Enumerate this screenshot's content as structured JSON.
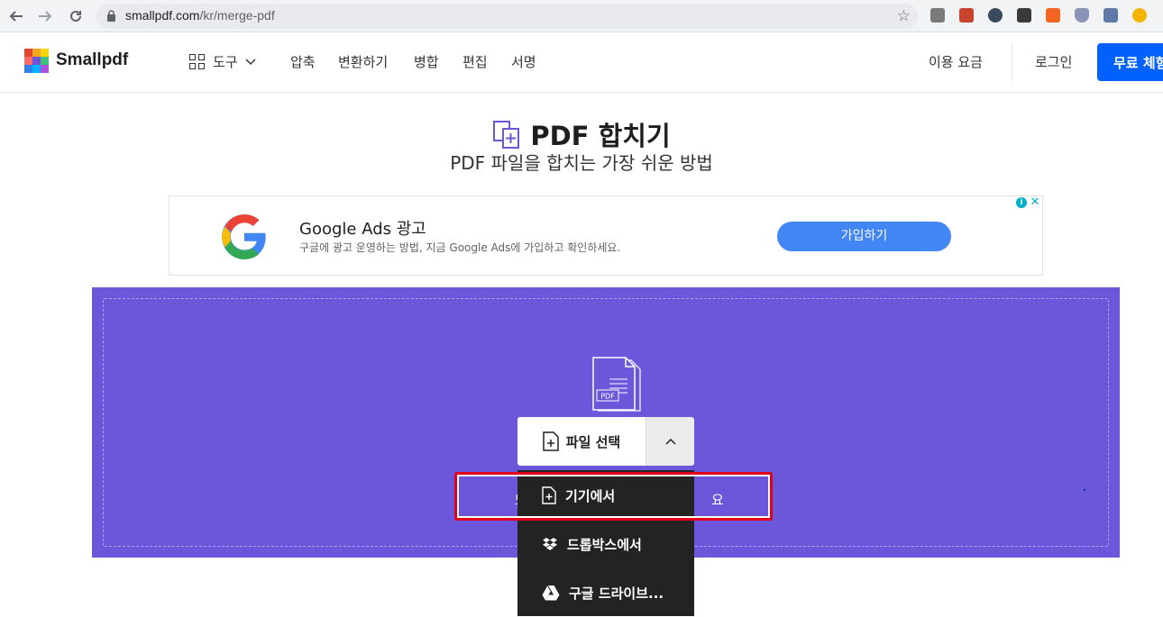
{
  "browser": {
    "url_host": "smallpdf.com",
    "url_path": "/kr/merge-pdf",
    "extension_colors": [
      "#7a7a7a",
      "#c9442c",
      "#3b4a5c",
      "#3a3a3a",
      "#f26522",
      "#8a94b8",
      "#5f7aa8",
      "#f4b400"
    ]
  },
  "header": {
    "brand": "Smallpdf",
    "tools_label": "도구",
    "menu": [
      "압축",
      "변환하기",
      "병합",
      "편집",
      "서명"
    ],
    "pricing": "이용 요금",
    "login": "로그인",
    "trial": "무료 체험",
    "logo_colors": [
      "#e6452b",
      "#f5a623",
      "#ffd400",
      "#ff6b6b",
      "#6c57da",
      "#3ec27e",
      "#2f80ed",
      "#00b2ff",
      "#b04fe0"
    ]
  },
  "hero": {
    "title": "PDF 합치기",
    "subtitle": "PDF 파일을 합치는 가장 쉬운 방법"
  },
  "ad": {
    "title": "Google Ads 광고",
    "description": "구글에 광고 운영하는 방법, 지금 Google Ads에 가입하고 확인하세요.",
    "button": "가입하기"
  },
  "dropzone": {
    "illustration_label": "PDF",
    "choose_button": "파일 선택",
    "hint_start": "또",
    "hint_end": "요",
    "background": "#6c57da"
  },
  "dropdown": {
    "items": [
      {
        "label": "기기에서",
        "icon": "file-plus-icon"
      },
      {
        "label": "드롭박스에서",
        "icon": "dropbox-icon"
      },
      {
        "label": "구글 드라이브...",
        "icon": "google-drive-icon"
      }
    ]
  }
}
